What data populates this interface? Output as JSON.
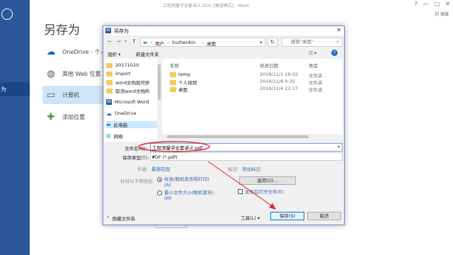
{
  "word": {
    "window_title": "工程测量学全套讲义.DOC [兼容模式] - Word",
    "window_controls": [
      "?",
      "—",
      "□",
      "✕"
    ],
    "user": "刘 振斌",
    "backstage_title": "另存为",
    "sidebar_selected": "为",
    "places": [
      {
        "label": "OneDrive - 个人",
        "icon": "cloud-icon"
      },
      {
        "label": "其他 Web 位置",
        "icon": "globe-icon"
      },
      {
        "label": "计算机",
        "icon": "computer-icon"
      },
      {
        "label": "添加位置",
        "icon": "plus-icon"
      }
    ]
  },
  "dialog": {
    "title": "另存为",
    "address": [
      "用户",
      "liuzhenbin",
      "桌面"
    ],
    "search_placeholder": "搜索\"桌面\"",
    "toolbar": {
      "organize": "组织 ▾",
      "new_folder": "新建文件夹"
    },
    "nav_items": [
      {
        "label": "20171020",
        "icon": "folder-icon"
      },
      {
        "label": "import",
        "icon": "folder-icon"
      },
      {
        "label": "word文档如何修",
        "icon": "folder-icon"
      },
      {
        "label": "取消word文档所",
        "icon": "folder-icon"
      },
      {
        "label": "Microsoft Word",
        "icon": "word-icon"
      },
      {
        "label": "OneDrive",
        "icon": "cloud-icon"
      },
      {
        "label": "此电脑",
        "icon": "computer-icon"
      },
      {
        "label": "网络",
        "icon": "network-icon"
      }
    ],
    "columns": {
      "name": "名称",
      "date": "修改日期",
      "type": "类型"
    },
    "files": [
      {
        "name": "temp",
        "date": "2018/11/1 19:02",
        "type": "文件夹"
      },
      {
        "name": "个人视频",
        "date": "2018/11/6 0:35",
        "type": "文件夹"
      },
      {
        "name": "桌面",
        "date": "2018/11/4 22:17",
        "type": "文件夹"
      }
    ],
    "filename_label": "文件名(N):",
    "filename_value": "工程测量学全套讲义.pdf",
    "filetype_label": "保存类型(T):",
    "filetype_value": "PDF (*.pdf)",
    "author_label": "作者:",
    "author_link": "最想花园",
    "tags_label": "标记:",
    "tags_link": "添加标记",
    "optimize_label": "针对以下项优化:",
    "optimize_standard": "标准(联机发布和打印)",
    "optimize_standard_key": "(A)",
    "optimize_min": "最小文件大小(联机发布)",
    "optimize_min_key": "(M)",
    "options_button": "选项(O)...",
    "open_after_publish": "发布后打开文件(E)",
    "hide_folders": "隐藏文件夹",
    "tools": "工具(L) ▾",
    "save_button": "保存(S)",
    "cancel_button": "取消"
  },
  "colors": {
    "word_blue": "#2b579a",
    "annotation_red": "#e0202a"
  }
}
